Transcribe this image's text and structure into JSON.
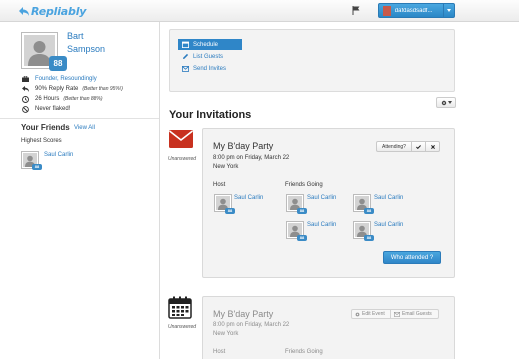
{
  "header": {
    "logo_text": "Repliably",
    "username": "dafdasdsadf..."
  },
  "profile": {
    "first_name": "Bart",
    "last_name": "Sampson",
    "score": "88",
    "stats": [
      {
        "icon": "briefcase-icon",
        "text": "Founder, Resoundingly",
        "sub": ""
      },
      {
        "icon": "reply-icon",
        "text": "90% Reply Rate",
        "sub": "(Better than 95%!)"
      },
      {
        "icon": "clock-icon",
        "text": "26 Hours",
        "sub": "(Better than 88%)"
      },
      {
        "icon": "ban-icon",
        "text": "Never flaked!",
        "sub": ""
      }
    ]
  },
  "friends": {
    "title": "Your Friends",
    "view_all": "View All",
    "highest_scores": "Highest Scores",
    "items": [
      {
        "name": "Saul Carlin",
        "score": "88"
      }
    ]
  },
  "actions": {
    "schedule": "Schedule",
    "list_guests": "List Guests",
    "send_invites": "Send Invites"
  },
  "invitations": {
    "title": "Your Invitations",
    "items": [
      {
        "status": "Unanswered",
        "title": "My B'day Party",
        "time": "8:00 pm on Friday, March 22",
        "location": "New York",
        "attending_label": "Attending?",
        "host_label": "Host",
        "friends_label": "Friends Going",
        "host": {
          "name": "Saul Carlin",
          "score": "88"
        },
        "friends_going": [
          {
            "name": "Saul Carlin",
            "score": "88"
          },
          {
            "name": "Saul Carlin",
            "score": "88"
          },
          {
            "name": "Saul Carlin",
            "score": "88"
          },
          {
            "name": "Saul Carlin",
            "score": "88"
          }
        ],
        "who_attended": "Who attended ?"
      },
      {
        "status": "Unanswered",
        "title": "My B'day Party",
        "time": "8:00 pm on Friday, March 22",
        "location": "New York",
        "edit_event": "Edit Event",
        "email_guests": "Email Guests",
        "host_label": "Host",
        "friends_label": "Friends Going"
      }
    ]
  },
  "colors": {
    "accent": "#2f86c8",
    "link": "#2a7bbf",
    "invite_red": "#cc3322"
  }
}
